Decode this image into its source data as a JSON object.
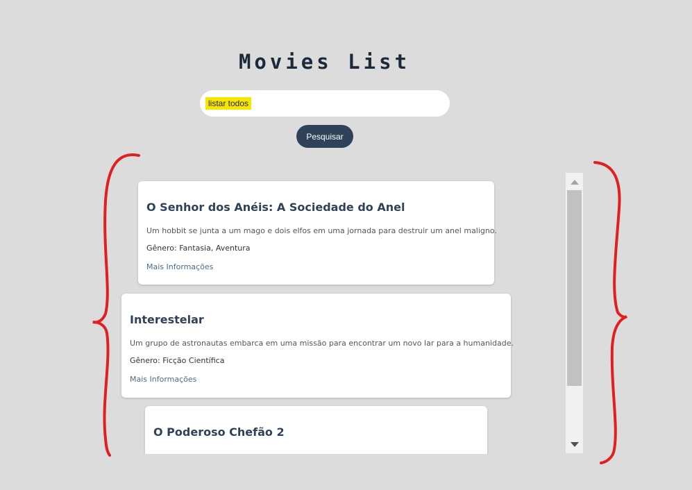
{
  "header": {
    "title": "Movies List"
  },
  "search": {
    "value": "listar todos",
    "button_label": "Pesquisar"
  },
  "movies": [
    {
      "title": "O Senhor dos Anéis: A Sociedade do Anel",
      "description": "Um hobbit se junta a um mago e dois elfos em uma jornada para destruir um anel maligno.",
      "genre": "Gênero: Fantasia, Aventura",
      "link": "Mais Informações"
    },
    {
      "title": "Interestelar",
      "description": "Um grupo de astronautas embarca em uma missão para encontrar um novo lar para a humanidade.",
      "genre": "Gênero: Ficção Científica",
      "link": "Mais Informações"
    },
    {
      "title": "O Poderoso Chefão 2"
    }
  ],
  "colors": {
    "background": "#dcdcdc",
    "primary": "#2f4259",
    "highlight": "#f7e600",
    "annotation": "#e02020"
  },
  "icons": {
    "scroll_up": "scroll-up-arrow-icon",
    "scroll_down": "scroll-down-arrow-icon"
  }
}
